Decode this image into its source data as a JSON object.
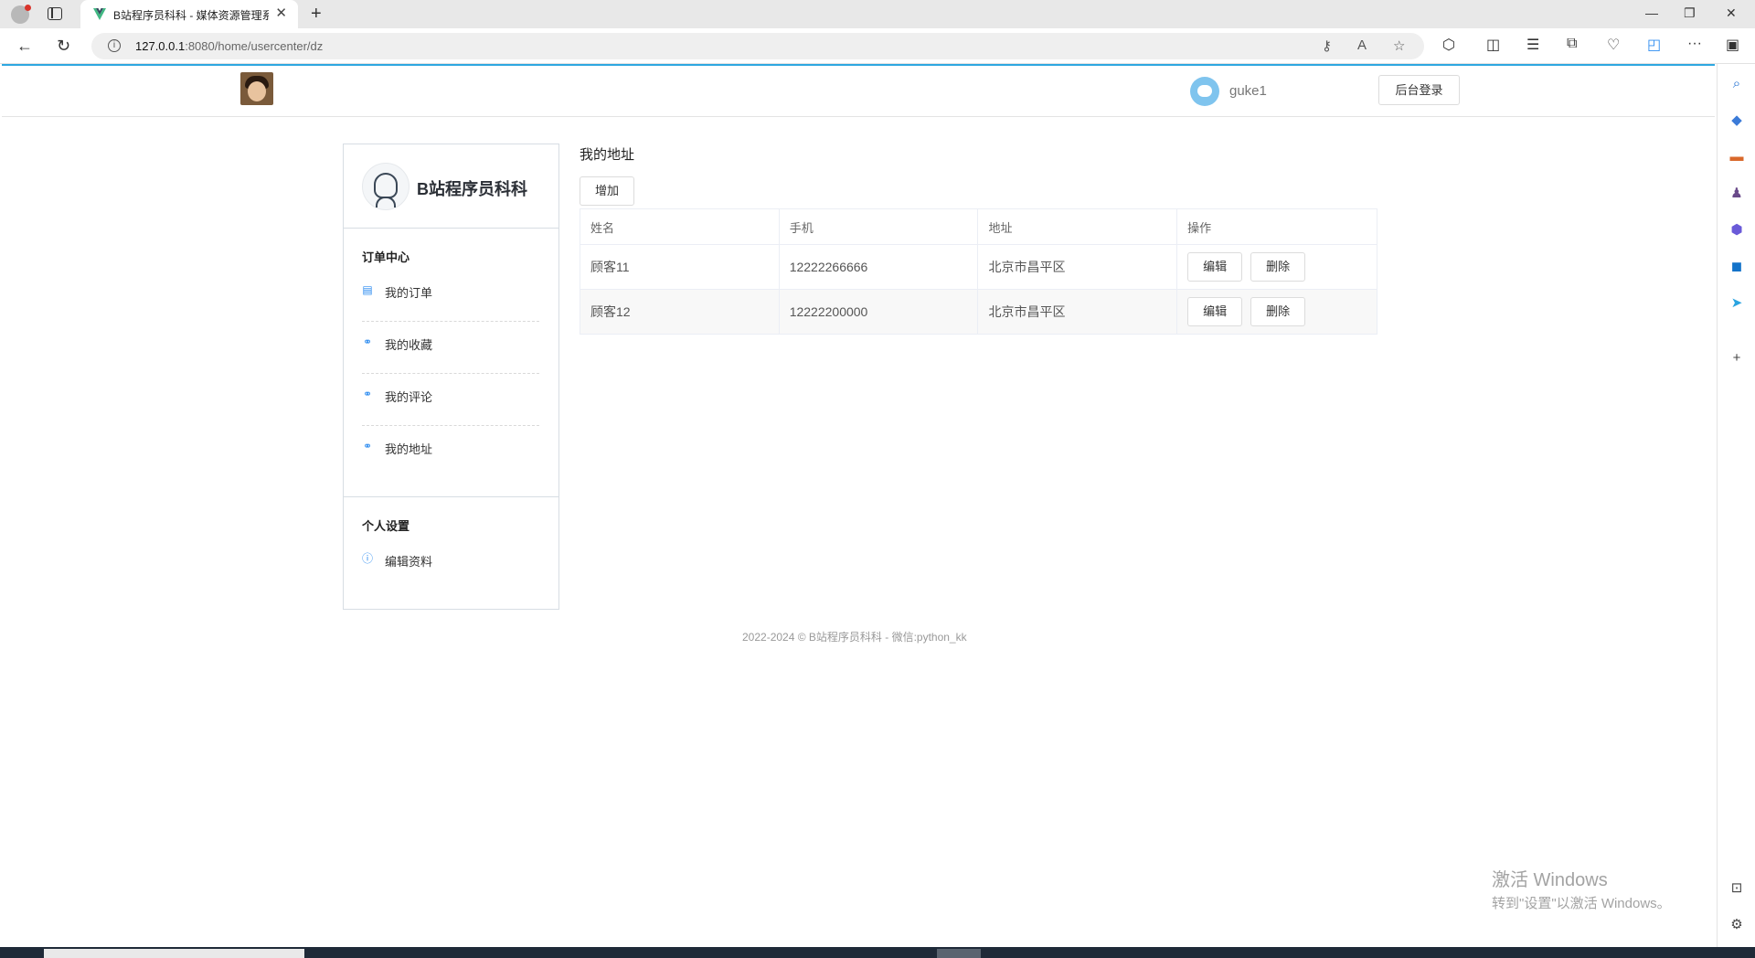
{
  "browser": {
    "tab_title": "B站程序员科科 - 媒体资源管理系",
    "url_host": "127.0.0.1",
    "url_path": ":8080/home/usercenter/dz"
  },
  "header": {
    "username": "guke1",
    "admin_login": "后台登录"
  },
  "sidebar": {
    "brand_name": "B站程序员科科",
    "order_section_title": "订单中心",
    "order_items": [
      {
        "label": "我的订单",
        "icon": "clipboard-icon"
      },
      {
        "label": "我的收藏",
        "icon": "link-icon"
      },
      {
        "label": "我的评论",
        "icon": "link-icon"
      },
      {
        "label": "我的地址",
        "icon": "link-icon"
      }
    ],
    "settings_section_title": "个人设置",
    "settings_items": [
      {
        "label": "编辑资料",
        "icon": "info-circle-icon"
      }
    ]
  },
  "main": {
    "title": "我的地址",
    "add_label": "增加",
    "columns": [
      "姓名",
      "手机",
      "地址",
      "操作"
    ],
    "rows": [
      {
        "name": "顾客11",
        "phone": "12222266666",
        "address": "北京市昌平区",
        "edit": "编辑",
        "delete": "删除"
      },
      {
        "name": "顾客12",
        "phone": "12222200000",
        "address": "北京市昌平区",
        "edit": "编辑",
        "delete": "删除"
      }
    ]
  },
  "footer": {
    "text": "2022-2024 © B站程序员科科 - 微信:python_kk"
  },
  "watermark": {
    "line1": "激活 Windows",
    "line2": "转到\"设置\"以激活 Windows。"
  },
  "colors": {
    "accent": "#2ea7e0",
    "menu_icon": "#2d8cf0",
    "border": "#d7dde3"
  }
}
